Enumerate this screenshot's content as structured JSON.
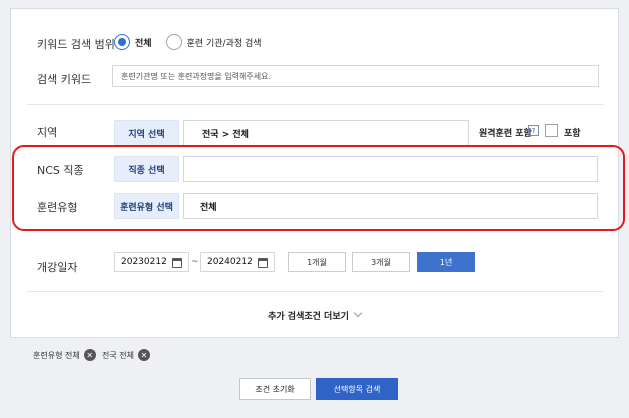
{
  "search_scope": {
    "label": "키워드 검색 범위",
    "options": [
      {
        "label": "전체",
        "selected": true
      },
      {
        "label": "훈련 기관/과정 검색",
        "selected": false
      }
    ]
  },
  "keyword": {
    "label": "검색 키워드",
    "placeholder": "훈련기관명 또는 훈련과정명을 입력해주세요."
  },
  "region": {
    "label": "지역",
    "select_label": "지역 선택",
    "value": "전국 > 전체",
    "remote_label": "원격훈련 포함",
    "help": "?",
    "include_label": "포함"
  },
  "ncs": {
    "label": "NCS 직종",
    "select_label": "직종 선택",
    "value": ""
  },
  "training_type": {
    "label": "훈련유형",
    "select_label": "훈련유형 선택",
    "value": "전체"
  },
  "start_date": {
    "label": "개강일자",
    "from": "20230212",
    "tilde": "~",
    "to": "20240212",
    "periods": [
      {
        "label": "1개월",
        "active": false
      },
      {
        "label": "3개월",
        "active": false
      },
      {
        "label": "1년",
        "active": true
      }
    ]
  },
  "more_conditions": "추가 검색조건 더보기",
  "tags": [
    {
      "label": "훈련유형 전체"
    },
    {
      "label": "전국 전체"
    }
  ],
  "buttons": {
    "reset": "조건 초기화",
    "search": "선택항목 검색"
  },
  "colors": {
    "accent": "#2f63c6",
    "highlight": "#e21a1a",
    "select_bg": "#e6eefb"
  }
}
